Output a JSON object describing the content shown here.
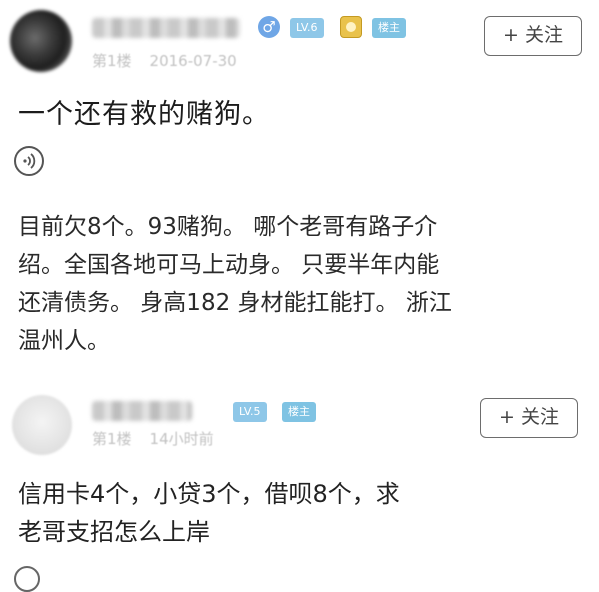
{
  "posts": [
    {
      "level": "LV.6",
      "owner_label": "楼主",
      "floor": "第1楼",
      "date": "2016-07-30",
      "follow_label": "+ 关注",
      "title": "一个还有救的赌狗。",
      "audio_icon": "audio-wave-icon",
      "body_lines": [
        "目前欠8个。93赌狗。 哪个老哥有路子介",
        "绍。全国各地可马上动身。 只要半年内能",
        "还清债务。 身高182 身材能扛能打。 浙江",
        "温州人。"
      ]
    },
    {
      "level": "LV.5",
      "owner_label": "楼主",
      "floor": "第1楼",
      "date": "14小时前",
      "follow_label": "+ 关注",
      "body_lines": [
        "信用卡4个，小贷3个，借呗8个，求",
        "老哥支招怎么上岸"
      ]
    }
  ],
  "colors": {
    "badge_blue": "#8ec7e8",
    "gender_blue": "#6fa6e6",
    "medal_gold": "#e9c24b",
    "meta_gray": "#c2c2c2"
  }
}
